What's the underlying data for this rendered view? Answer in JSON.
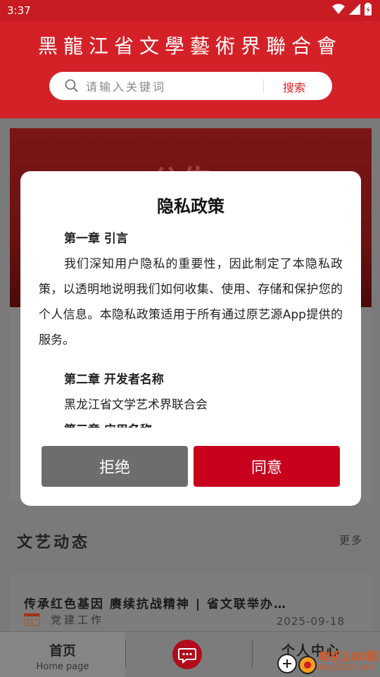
{
  "status_bar": {
    "time": "3:37"
  },
  "header": {
    "title": "黑龍江省文學藝術界聯合會"
  },
  "search": {
    "placeholder": "请输入关键词",
    "button_label": "搜索"
  },
  "banner": {
    "text": "公告"
  },
  "section": {
    "title": "文艺动态",
    "more_label": "更多"
  },
  "news": [
    {
      "title": "传承红色基因 赓续抗战精神 | 省文联举办…",
      "category": "党建工作",
      "date": "2025-09-18"
    }
  ],
  "tab_bar": {
    "home_label": "首页",
    "home_sub": "Home page",
    "profile_label": "个人中心"
  },
  "watermark": {
    "text": "单机100网",
    "sub": "danji100.com"
  },
  "modal": {
    "title": "隐私政策",
    "chapter1_heading": "第一章 引言",
    "chapter1_text": "我们深知用户隐私的重要性，因此制定了本隐私政策，以透明地说明我们如何收集、使用、存储和保护您的个人信息。本隐私政策适用于所有通过原艺源App提供的服务。",
    "chapter2_heading": "第二章 开发者名称",
    "chapter2_text": "黑龙江省文学艺术界联合会",
    "chapter3_heading": "第三章 应用名称",
    "reject_label": "拒绝",
    "agree_label": "同意"
  },
  "colors": {
    "brand_red": "#d42128",
    "agree_button": "#c8001e",
    "reject_button": "#6d6d6d"
  }
}
